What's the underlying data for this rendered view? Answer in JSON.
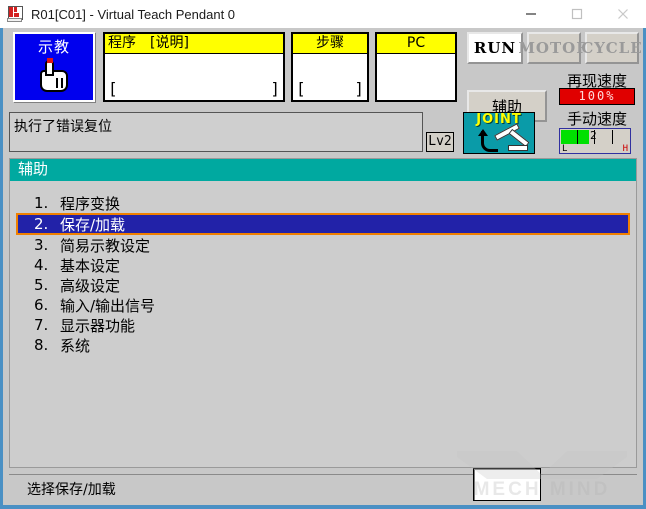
{
  "window": {
    "title": "R01[C01] - Virtual Teach Pendant 0",
    "icon": "app-icon",
    "controls": {
      "minimize": "minimize-icon",
      "maximize": "maximize-icon",
      "close": "close-icon"
    }
  },
  "status_strip": {
    "mode_button": {
      "label": "示教",
      "icon": "hand-pointer-icon"
    },
    "boxes": [
      {
        "id": "program",
        "header": "程序　[说明]",
        "value": "",
        "bracket_left": "[",
        "bracket_right": "]",
        "align": "left"
      },
      {
        "id": "step",
        "header": "步骤",
        "value": "",
        "bracket_left": "[",
        "bracket_right": "]",
        "align": "center"
      },
      {
        "id": "pc",
        "header": "PC",
        "value": "",
        "bracket_left": "",
        "bracket_right": "",
        "align": "center"
      }
    ],
    "mode_buttons": [
      {
        "id": "run",
        "label": "RUN",
        "state": "active"
      },
      {
        "id": "motor",
        "label": "MOTOR",
        "state": "disabled"
      },
      {
        "id": "cycle",
        "label": "CYCLE",
        "state": "disabled"
      }
    ],
    "aux_button": "辅助",
    "play_speed": {
      "label": "再现速度",
      "value": "100%",
      "color": "#e00000"
    },
    "manual_speed": {
      "label": "手动速度",
      "value": "2",
      "low": "L",
      "high": "H",
      "bar_color": "#00e000"
    }
  },
  "message_row": {
    "message": "执行了错误复位",
    "level_badge": "Lv2",
    "coord_icon": {
      "label": "JOINT",
      "icon": "robot-arm-icon",
      "color": "#0a9ba8"
    }
  },
  "panel": {
    "header": "辅助",
    "menu": [
      {
        "num": "1.",
        "label": "程序变换",
        "selected": false
      },
      {
        "num": "2.",
        "label": "保存/加载",
        "selected": true
      },
      {
        "num": "3.",
        "label": "简易示教设定",
        "selected": false
      },
      {
        "num": "4.",
        "label": "基本设定",
        "selected": false
      },
      {
        "num": "5.",
        "label": "高级设定",
        "selected": false
      },
      {
        "num": "6.",
        "label": "输入/输出信号",
        "selected": false
      },
      {
        "num": "7.",
        "label": "显示器功能",
        "selected": false
      },
      {
        "num": "8.",
        "label": "系统",
        "selected": false
      }
    ],
    "selection_colors": {
      "background": "#2222a8",
      "border": "#f08000",
      "text": "#ffffff"
    },
    "header_color": "#00a9a0"
  },
  "status_bar": {
    "text": "选择保存/加载",
    "input_value": ""
  },
  "watermark": {
    "text": "MECH MIND"
  }
}
